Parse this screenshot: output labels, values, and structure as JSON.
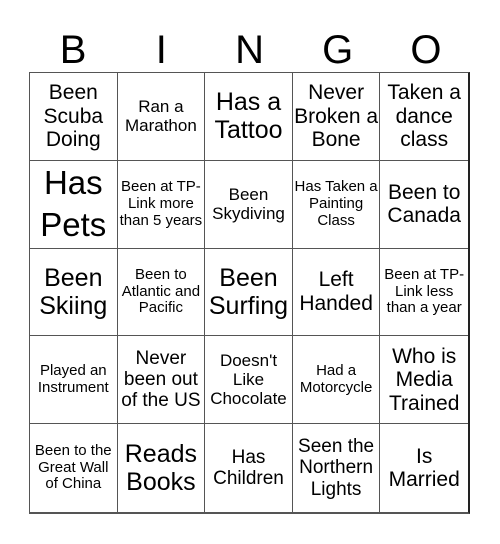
{
  "title_letters": [
    "B",
    "I",
    "N",
    "G",
    "O"
  ],
  "cells": [
    "Been Scuba Doing",
    "Ran a Marathon",
    "Has a Tattoo",
    "Never Broken a Bone",
    "Taken a dance class",
    "Has Pets",
    "Been at TP-Link more than 5 years",
    "Been Skydiving",
    "Has Taken a Painting Class",
    "Been to Canada",
    "Been Skiing",
    "Been to Atlantic and Pacific",
    "Been Surfing",
    "Left Handed",
    "Been at TP-Link less than a year",
    "Played an Instrument",
    "Never been out of the US",
    "Doesn't Like Chocolate",
    "Had a Motorcycle",
    "Who is Media Trained",
    "Been to the Great Wall of China",
    "Reads Books",
    "Has Children",
    "Seen the Northern Lights",
    "Is Married"
  ]
}
